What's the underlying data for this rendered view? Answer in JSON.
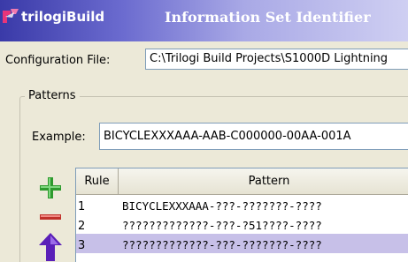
{
  "window": {
    "app_name": "trilogiBuild",
    "title": "Information Set Identifier"
  },
  "config": {
    "label": "Configuration File:",
    "value": "C:\\Trilogi Build Projects\\S1000D Lightning"
  },
  "patterns": {
    "legend": "Patterns",
    "example_label": "Example:",
    "example_value": "BICYCLEXXXAAA-AAB-C000000-00AA-001A"
  },
  "buttons": {
    "add_color": "#2e9a2e",
    "remove_color": "#c0302a",
    "up_color": "#5a1fb8"
  },
  "table": {
    "columns": [
      "Rule",
      "Pattern"
    ],
    "rows": [
      {
        "rule": "1",
        "pattern": "BICYCLEXXXAAA-???-???????-????"
      },
      {
        "rule": "2",
        "pattern": "?????????????-???-?51????-????"
      },
      {
        "rule": "3",
        "pattern": "?????????????-???-???????-????"
      }
    ],
    "selected_row": 3
  }
}
